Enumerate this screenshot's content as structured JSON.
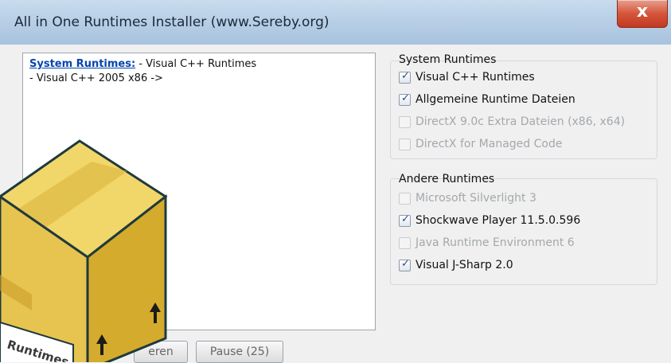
{
  "window": {
    "title": "All in One Runtimes Installer (www.Sereby.org)",
    "close_glyph": "x"
  },
  "log": {
    "link_text": "System Runtimes:",
    "line1_rest": " - Visual C++ Runtimes",
    "line2": " - Visual C++ 2005 x86 ->"
  },
  "system_runtimes": {
    "label": "System Runtimes",
    "options": [
      {
        "label": "Visual C++ Runtimes",
        "checked": true,
        "enabled": true
      },
      {
        "label": "Allgemeine Runtime Dateien",
        "checked": true,
        "enabled": true
      },
      {
        "label": "DirectX 9.0c Extra Dateien (x86, x64)",
        "checked": false,
        "enabled": false
      },
      {
        "label": "DirectX for Managed Code",
        "checked": false,
        "enabled": false
      }
    ]
  },
  "other_runtimes": {
    "label": "Andere Runtimes",
    "options": [
      {
        "label": "Microsoft Silverlight 3",
        "checked": false,
        "enabled": false
      },
      {
        "label": "Shockwave Player 11.5.0.596",
        "checked": true,
        "enabled": true
      },
      {
        "label": "Java Runtime Environment 6",
        "checked": false,
        "enabled": false
      },
      {
        "label": "Visual J-Sharp 2.0",
        "checked": true,
        "enabled": true
      }
    ]
  },
  "buttons": {
    "install_partial": "eren",
    "pause": "Pause (25)"
  },
  "box_label": "Runtimes",
  "colors": {
    "box_front": "#e7c350",
    "box_top": "#f1d66a",
    "box_side": "#d4ab2c",
    "box_outline": "#1f3a3c",
    "link": "#0645ad"
  }
}
